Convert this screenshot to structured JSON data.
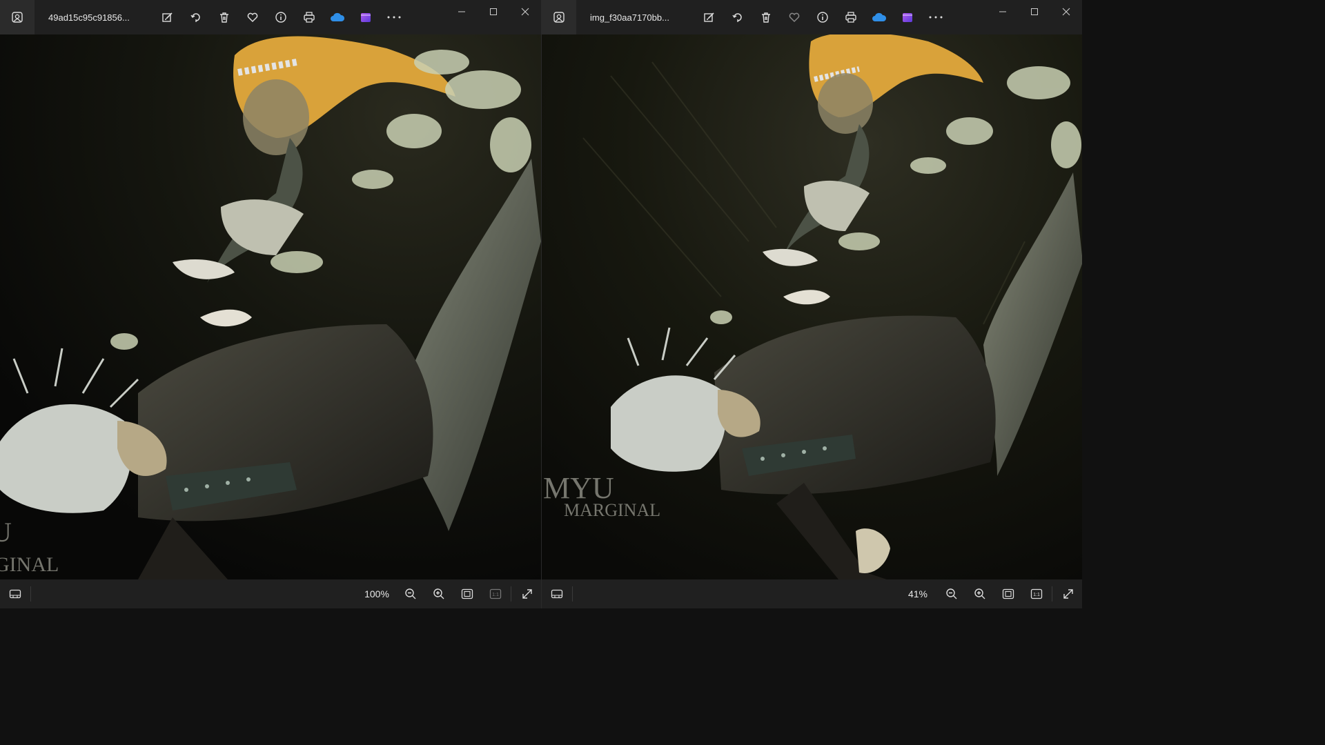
{
  "windows": [
    {
      "filename": "49ad15c95c91856...",
      "zoom": "100%",
      "favorite_filled": false,
      "watermark": {
        "line1": "U",
        "line2": "GINAL"
      }
    },
    {
      "filename": "img_f30aa7170bb...",
      "zoom": "41%",
      "favorite_filled": false,
      "watermark": {
        "line1": "MYU",
        "line2": "MARGINAL"
      }
    }
  ],
  "icons": {
    "app": "photos-app-icon",
    "edit": "edit-image-icon",
    "rotate": "rotate-icon",
    "delete": "trash-icon",
    "favorite": "heart-icon",
    "info": "info-icon",
    "print": "print-icon",
    "onedrive": "onedrive-cloud-icon",
    "clipchamp": "clipchamp-icon",
    "more": "more-options-icon",
    "minimize": "minimize-icon",
    "maximize": "maximize-icon",
    "close": "close-icon",
    "filmstrip": "filmstrip-icon",
    "zoom_out": "zoom-out-icon",
    "zoom_in": "zoom-in-icon",
    "fit": "fit-to-window-icon",
    "actual_size": "actual-size-icon",
    "fullscreen": "fullscreen-icon"
  },
  "colors": {
    "toolbar_bg": "#202020",
    "onedrive_blue": "#2f8fe8",
    "clipchamp_purple": "#7b52e6",
    "hair_gold": "#d9a23a",
    "hair_white": "#c9cdc6"
  }
}
